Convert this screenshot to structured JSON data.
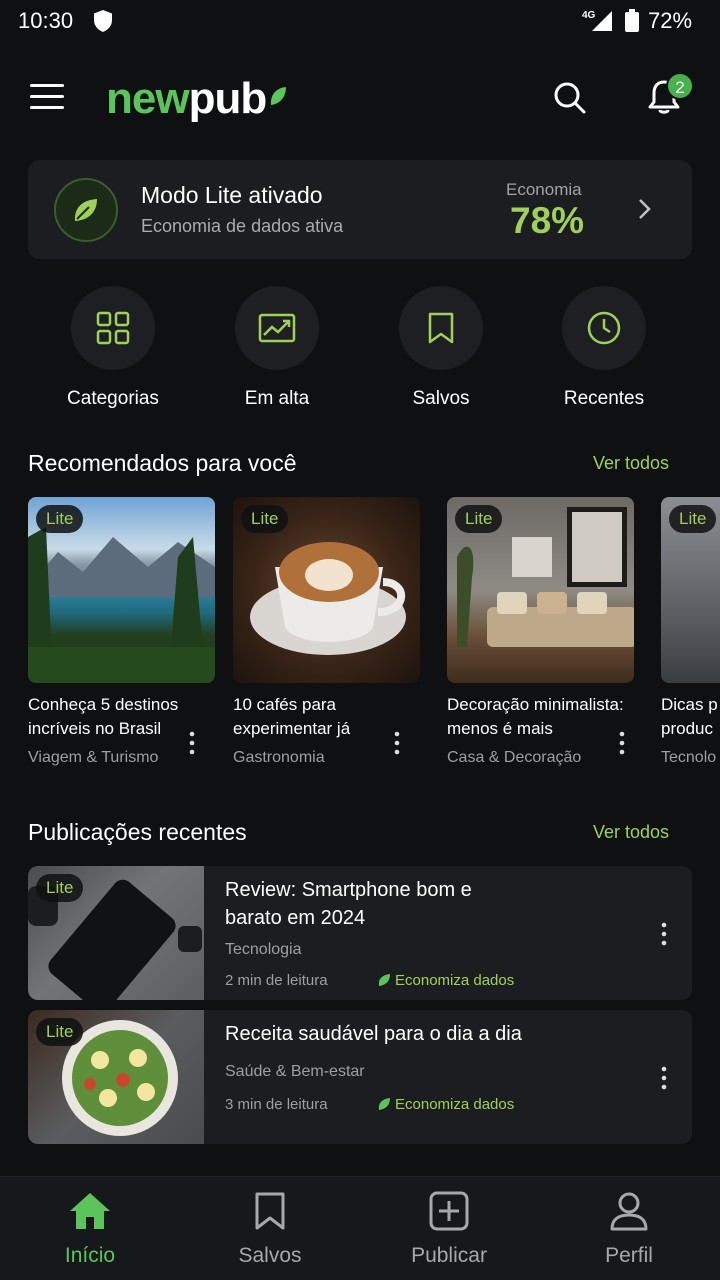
{
  "status_bar": {
    "time": "10:30",
    "network": "4G",
    "battery": "72%"
  },
  "app": {
    "logo_part1": "new",
    "logo_part2": "pub",
    "notification_count": "2"
  },
  "lite_banner": {
    "title": "Modo Lite ativado",
    "subtitle": "Economia de dados ativa",
    "economy_label": "Economia",
    "economy_value": "78%"
  },
  "quick_actions": [
    {
      "label": "Categorias",
      "icon": "grid-icon"
    },
    {
      "label": "Em alta",
      "icon": "trending-icon"
    },
    {
      "label": "Salvos",
      "icon": "bookmark-icon"
    },
    {
      "label": "Recentes",
      "icon": "clock-icon"
    }
  ],
  "recommended": {
    "title": "Recomendados para você",
    "see_all": "Ver todos",
    "items": [
      {
        "badge": "Lite",
        "title": "Conheça 5 destinos incríveis no Brasil",
        "category": "Viagem & Turismo"
      },
      {
        "badge": "Lite",
        "title": "10 cafés para experimentar já",
        "category": "Gastronomia"
      },
      {
        "badge": "Lite",
        "title": "Decoração minimalista: menos é mais",
        "category": "Casa & Decoração"
      },
      {
        "badge": "Lite",
        "title": "Dicas p produc",
        "category": "Tecnolo"
      }
    ]
  },
  "recent": {
    "title": "Publicações recentes",
    "see_all": "Ver todos",
    "items": [
      {
        "badge": "Lite",
        "title": "Review: Smartphone bom e barato em 2024",
        "category": "Tecnologia",
        "read_time": "2 min de leitura",
        "saves": "Economiza dados"
      },
      {
        "badge": "Lite",
        "title": "Receita saudável para o dia a dia",
        "category": "Saúde & Bem-estar",
        "read_time": "3 min de leitura",
        "saves": "Economiza dados"
      }
    ]
  },
  "bottom_nav": [
    {
      "label": "Início",
      "icon": "home-icon",
      "active": true
    },
    {
      "label": "Salvos",
      "icon": "bookmark-icon"
    },
    {
      "label": "Publicar",
      "icon": "plus-square-icon"
    },
    {
      "label": "Perfil",
      "icon": "user-icon"
    }
  ],
  "colors": {
    "accent": "#5cc45d",
    "lime": "#9fd15a",
    "background": "#0f1012",
    "card": "#1c1d20"
  }
}
